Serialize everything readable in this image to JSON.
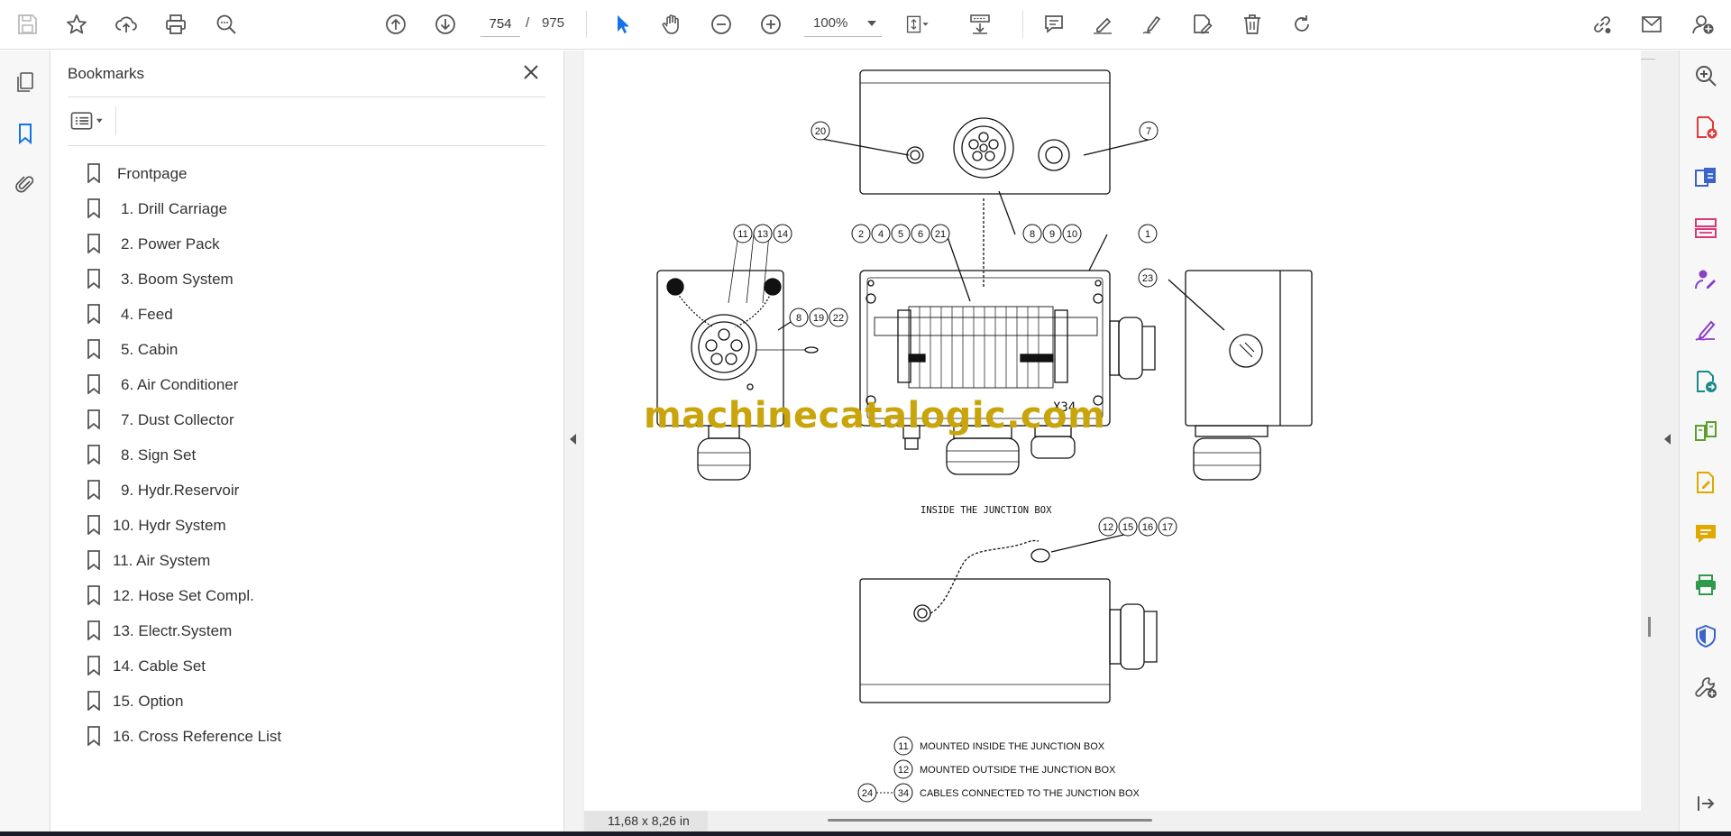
{
  "toolbar": {
    "current_page": "754",
    "page_separator": "/",
    "total_pages": "975",
    "zoom": "100%"
  },
  "bookmarks_panel": {
    "title": "Bookmarks",
    "items": [
      {
        "label": "Frontpage"
      },
      {
        "label": "1. Drill Carriage"
      },
      {
        "label": "2. Power Pack"
      },
      {
        "label": "3. Boom System"
      },
      {
        "label": "4. Feed"
      },
      {
        "label": "5. Cabin"
      },
      {
        "label": "6. Air Conditioner"
      },
      {
        "label": "7. Dust Collector"
      },
      {
        "label": "8. Sign Set"
      },
      {
        "label": "9. Hydr.Reservoir"
      },
      {
        "label": "10. Hydr System"
      },
      {
        "label": "11. Air System"
      },
      {
        "label": "12. Hose Set Compl."
      },
      {
        "label": "13. Electr.System"
      },
      {
        "label": "14. Cable Set"
      },
      {
        "label": "15. Option"
      },
      {
        "label": "16. Cross Reference List"
      }
    ]
  },
  "document": {
    "watermark": "machinecatalogic.com",
    "page_size": "11,68 x 8,26 in",
    "drawing": {
      "caption_inside": "INSIDE THE JUNCTION BOX",
      "box_label": "X34",
      "callouts_top_left": [
        "20"
      ],
      "callouts_top_right": [
        "7"
      ],
      "callouts_left_group": [
        "11",
        "13",
        "14"
      ],
      "callouts_center_group": [
        "2",
        "4",
        "5",
        "6",
        "21"
      ],
      "callouts_center_right": [
        "8",
        "9",
        "10"
      ],
      "callouts_right": [
        "1"
      ],
      "callouts_side": [
        "8",
        "19",
        "22"
      ],
      "callouts_end": [
        "23"
      ],
      "callouts_bottom": [
        "12",
        "15",
        "16",
        "17"
      ],
      "legend": [
        {
          "num": "11",
          "text": "MOUNTED INSIDE THE JUNCTION BOX"
        },
        {
          "num": "12",
          "text": "MOUNTED OUTSIDE THE JUNCTION BOX"
        },
        {
          "num": "24",
          "num2": "34",
          "text": "CABLES CONNECTED TO THE JUNCTION BOX"
        }
      ]
    }
  },
  "colors": {
    "accent_blue": "#1473e6",
    "watermark": "#c9a40a"
  }
}
